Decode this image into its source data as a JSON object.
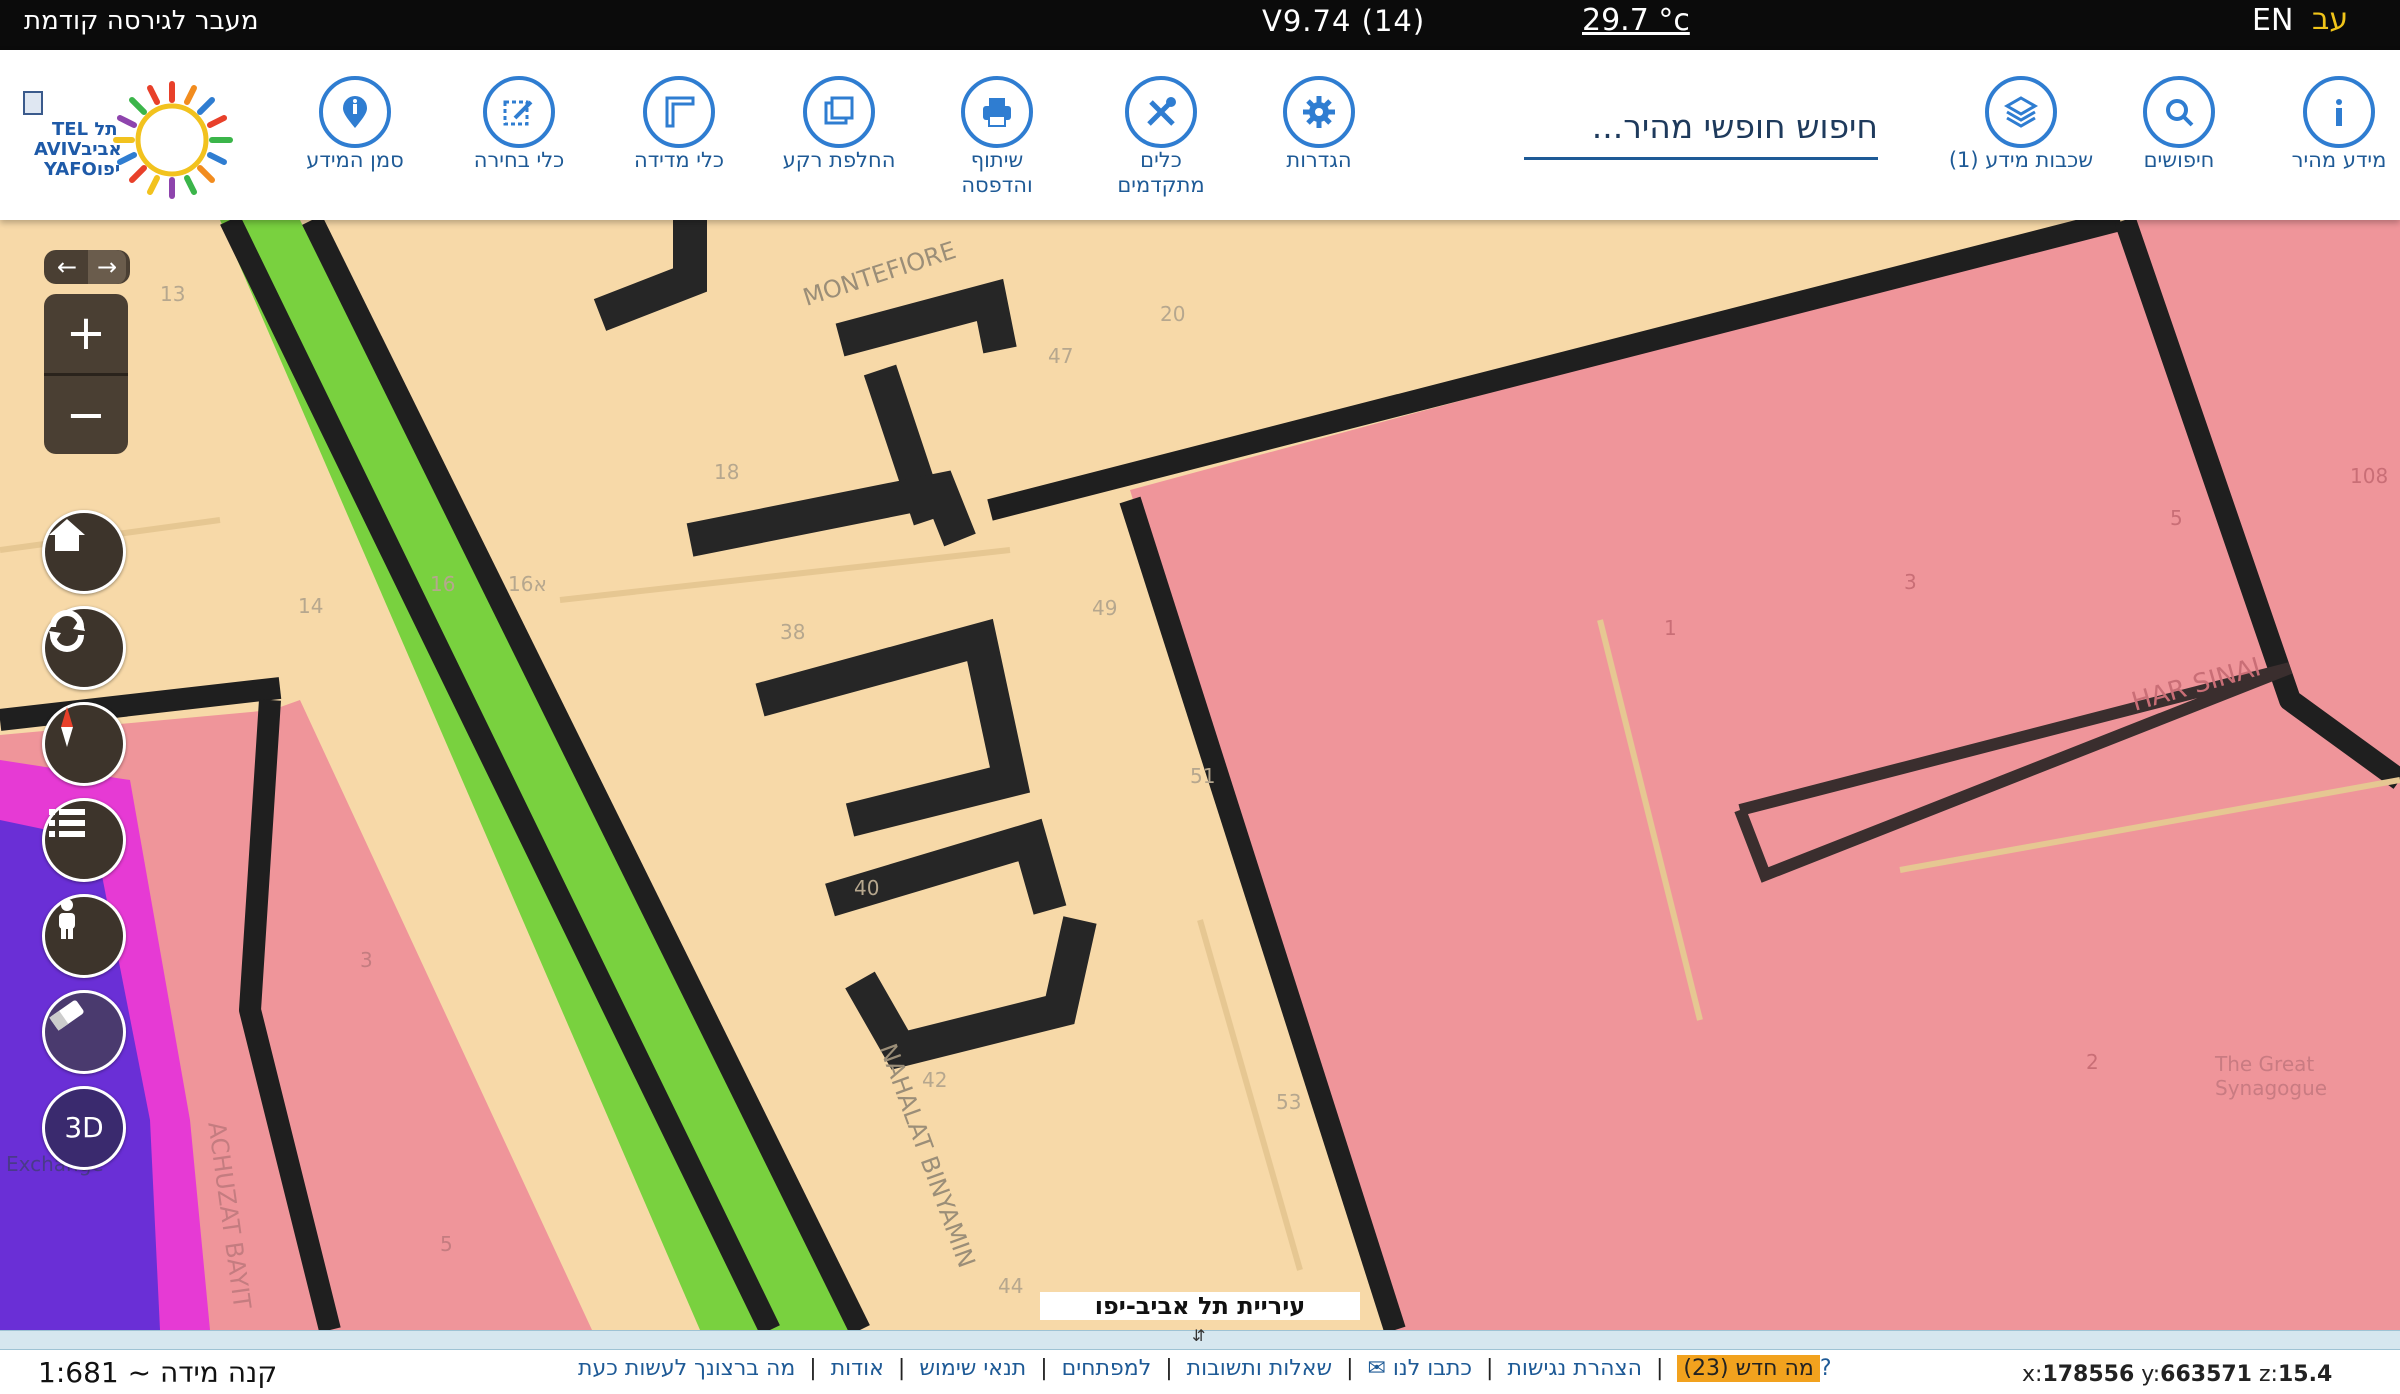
{
  "topbar": {
    "prev_version_link": "מעבר לגירסה קודמת",
    "version": "V9.74 (14)",
    "temperature": "29.7 °c",
    "lang_en": "EN",
    "lang_he": "עב"
  },
  "toolbar": {
    "search_placeholder": "חיפוש חופשי מהיר...",
    "tools": [
      {
        "label": "מידע מהיר",
        "icon": "info-icon"
      },
      {
        "label": "חיפושים",
        "icon": "search-icon"
      },
      {
        "label": "שכבות מידע (1)",
        "icon": "layers-icon"
      },
      {
        "label": "הגדרות",
        "icon": "gear-icon"
      },
      {
        "label": "כלים מתקדמים",
        "icon": "tools-icon"
      },
      {
        "label": "שיתוף והדפסה",
        "icon": "print-icon"
      },
      {
        "label": "החלפת רקע",
        "icon": "basemap-icon"
      },
      {
        "label": "כלי מדידה",
        "icon": "ruler-icon"
      },
      {
        "label": "כלי בחירה",
        "icon": "select-icon"
      },
      {
        "label": "סמן המידע",
        "icon": "info-marker-icon"
      }
    ],
    "logo": {
      "he_top": "תל",
      "he_mid": "אביב",
      "he_bottom": "יפו",
      "en_top": "TEL",
      "en_mid": "AVIV",
      "en_bottom": "YAFO"
    }
  },
  "map": {
    "street_labels": [
      "MONTEFIORE",
      "NAHALAT BINYAMIN",
      "HAR SINAI",
      "ACHUZAT BAYIT"
    ],
    "poi_labels": [
      "The Great Synagogue",
      "Exchange"
    ],
    "parcel_numbers": [
      "13",
      "20",
      "47",
      "18",
      "16",
      "14",
      "38",
      "49",
      "40",
      "42",
      "53",
      "44",
      "3",
      "5",
      "51",
      "1",
      "3",
      "5",
      "2",
      "108",
      "א16"
    ],
    "city_label": "עיריית תל אביב-יפו",
    "controls_3d_label": "3D"
  },
  "bottombar": {
    "scale": "קנה מידה ~ 1:681",
    "links": [
      "מה ברצונך לעשות כעת?",
      "אודות",
      "תנאי שימוש",
      "למפתחים",
      "שאלות ותשובות",
      "כתבו לנו ✉",
      "הצהרת נגישות"
    ],
    "whats_new": "מה חדש (23)",
    "coord_x_label": "x:",
    "coord_x": "178556",
    "coord_y_label": "y:",
    "coord_y": "663571",
    "coord_z_label": "z:",
    "coord_z": "15.4"
  },
  "colors": {
    "topbar_bg": "#0b0b0b",
    "accent_blue": "#2f7dd1",
    "map_residential": "#f7d9a8",
    "map_commercial": "#ef959a",
    "map_green": "#79d13f",
    "map_magenta": "#e63ad4",
    "map_purple": "#6a2fd6",
    "control_dark": "#3d342b",
    "whats_new_bg": "#f2a21e"
  }
}
